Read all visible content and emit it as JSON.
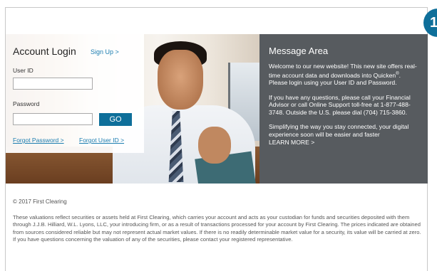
{
  "badge": {
    "text": "1"
  },
  "login": {
    "title": "Account Login",
    "signup_label": "Sign Up >",
    "user_id_label": "User ID",
    "user_id_value": "",
    "password_label": "Password",
    "password_value": "",
    "go_label": "GO",
    "forgot_password_label": "Forgot Password >",
    "forgot_user_id_label": "Forgot User ID >"
  },
  "message_area": {
    "title": "Message Area",
    "p1_text": "Welcome to our new website! This new site offers real-time account data and downloads into Quicken",
    "p1_sup": "®",
    "p1_tail": ". Please login using your User ID and Password.",
    "p2": "If you have any questions, please call your Financial Advisor or call Online Support toll-free at 1-877-488-3748. Outside the U.S. please dial (704) 715-3860.",
    "p3": "Simplifying the way you stay connected, your digital experience soon will be easier and faster",
    "learn_more": "LEARN MORE >"
  },
  "footer": {
    "copyright": "© 2017 First Clearing",
    "disclaimer": "These valuations reflect securities or assets held at First Clearing, which carries your account and acts as your custodian for funds and securities deposited with them through J.J.B. Hilliard, W.L. Lyons, LLC, your introducing firm, or as a result of transactions processed for your account by First Clearing. The prices indicated are obtained from sources considered reliable but may not represent actual market values. If there is no readily determinable market value for a security, its value will be carried at zero. If you have questions concerning the valuation of any of the securities, please contact your registered representative."
  },
  "colors": {
    "accent": "#0e6f9a",
    "link": "#1b7db0",
    "message_bg": "#575b5f"
  }
}
